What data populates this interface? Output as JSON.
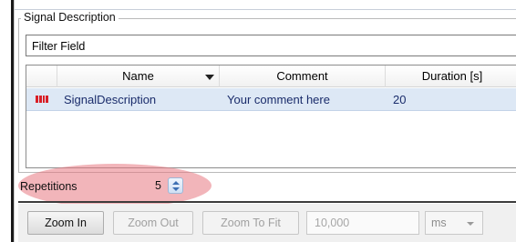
{
  "group": {
    "title": "Signal Description"
  },
  "filter": {
    "label": "Filter Field"
  },
  "grid": {
    "columns": [
      "Name",
      "Comment",
      "Duration [s]"
    ],
    "rows": [
      {
        "icon": "signal-icon",
        "name": "SignalDescription",
        "comment": "Your comment here",
        "duration": "20"
      }
    ]
  },
  "repetitions": {
    "label": "Repetitions",
    "value": "5"
  },
  "toolbar": {
    "zoom_in": "Zoom In",
    "zoom_out": "Zoom Out",
    "zoom_to_fit": "Zoom To Fit",
    "zoom_value": "10,000",
    "unit": "ms"
  },
  "colors": {
    "row_selected": "#dde8f5",
    "row_text": "#1a2c6b",
    "signal_icon": "#d81f26",
    "highlight": "#e87882"
  }
}
